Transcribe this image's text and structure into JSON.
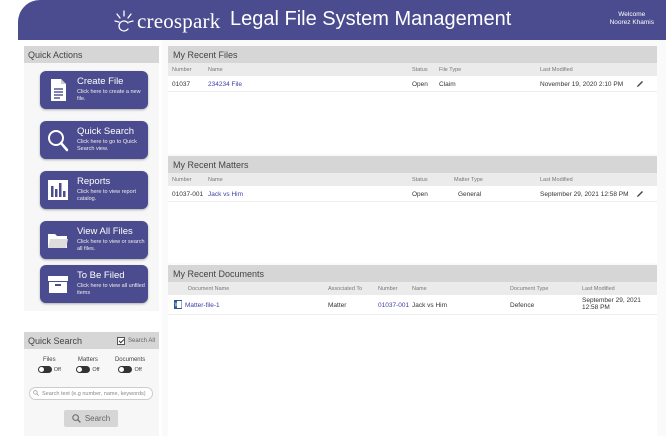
{
  "header": {
    "logo_text": "creospark",
    "app_title": "Legal File System Management",
    "welcome_line1": "Welcome",
    "welcome_line2": "Noorez Khamis"
  },
  "quick_actions": {
    "title": "Quick Actions",
    "buttons": [
      {
        "label": "Create File",
        "desc": "Click here to create a new file.",
        "icon": "document-icon"
      },
      {
        "label": "Quick Search",
        "desc": "Click here to go to Quick Search view.",
        "icon": "search-icon"
      },
      {
        "label": "Reports",
        "desc": "Click here to view report catalog.",
        "icon": "bar-chart-icon"
      },
      {
        "label": "View All Files",
        "desc": "Click here to view or search all files.",
        "icon": "folder-icon"
      },
      {
        "label": "To Be Filed",
        "desc": "Click here to view all unfiled items",
        "icon": "archive-box-icon"
      }
    ]
  },
  "quick_search": {
    "title": "Quick Search",
    "search_all_label": "Search All",
    "toggles": [
      {
        "label": "Files",
        "state": "Off"
      },
      {
        "label": "Matters",
        "state": "Off"
      },
      {
        "label": "Documents",
        "state": "Off"
      }
    ],
    "input_placeholder": "Search text (e.g number, name, keywords)",
    "button_label": "Search"
  },
  "recent_files": {
    "title": "My Recent Files",
    "columns": [
      "Number",
      "Name",
      "Status",
      "File Type",
      "Last Modified"
    ],
    "rows": [
      {
        "number": "01037",
        "name": "234234 File",
        "status": "Open",
        "type": "Claim",
        "modified": "November 19, 2020 2:10 PM"
      }
    ]
  },
  "recent_matters": {
    "title": "My Recent Matters",
    "columns": [
      "Number",
      "Name",
      "Status",
      "Matter Type",
      "Last Modified"
    ],
    "rows": [
      {
        "number": "01037-001",
        "name": "Jack vs Him",
        "status": "Open",
        "type": "General",
        "modified": "September 29, 2021 12:58 PM"
      }
    ]
  },
  "recent_documents": {
    "title": "My Recent Documents",
    "columns": [
      "Document Name",
      "Associated To",
      "Number",
      "Name",
      "Document Type",
      "Last Modified"
    ],
    "rows": [
      {
        "doc_name": "Matter-file-1",
        "assoc": "Matter",
        "number": "01037-001",
        "name": "Jack vs Him",
        "doc_type": "Defence",
        "modified_line1": "September 29, 2021",
        "modified_line2": "12:58 PM"
      }
    ]
  },
  "colors": {
    "brand": "#4b4b8f",
    "link": "#3e3ea5",
    "panel_header": "#d6d6d6"
  }
}
